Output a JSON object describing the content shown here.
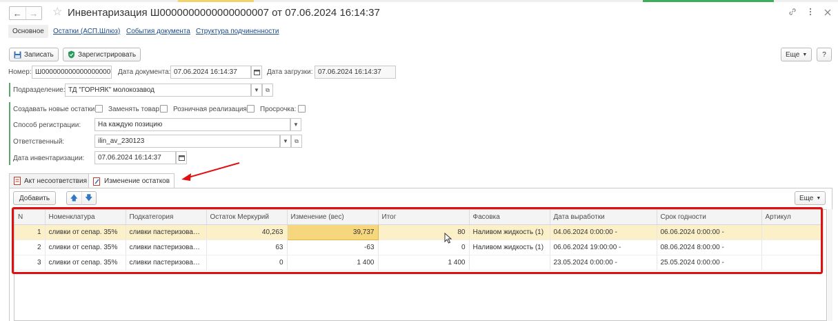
{
  "window": {
    "title": "Инвентаризация Ш0000000000000000007 от 07.06.2024 16:14:37",
    "nav_back": "←",
    "nav_forward": "→",
    "star": "☆",
    "icons": [
      "link-icon",
      "more-icon",
      "close-icon"
    ]
  },
  "sections": {
    "main": "Основное",
    "links": [
      "Остатки (АСП.Шлюз)",
      "События документа",
      "Структура подчиненности"
    ]
  },
  "toolbar": {
    "save_label": "Записать",
    "register_label": "Зарегистрировать",
    "more_label": "Еще",
    "help_label": "?"
  },
  "header": {
    "number_label": "Номер:",
    "number_value": "Ш0000000000000000007",
    "doc_date_label": "Дата документа:",
    "doc_date_value": "07.06.2024 16:14:37",
    "load_date_label": "Дата загрузки:",
    "load_date_value": "07.06.2024 16:14:37",
    "division_label": "Подразделение:",
    "division_value": "ТД \"ГОРНЯК\" молокозавод"
  },
  "options": {
    "create_new_label": "Создавать новые остатки:",
    "replace_goods_label": "Заменять товар:",
    "retail_label": "Розничная реализация:",
    "expired_label": "Просрочка:",
    "reg_method_label": "Способ регистрации:",
    "reg_method_value": "На каждую позицию",
    "responsible_label": "Ответственный:",
    "responsible_value": "ilin_av_230123",
    "inv_date_label": "Дата инвентаризации:",
    "inv_date_value": "07.06.2024 16:14:37"
  },
  "tabs": [
    {
      "label": "Акт несоответствия"
    },
    {
      "label": "Изменение остатков"
    }
  ],
  "table_toolbar": {
    "add_label": "Добавить",
    "up": "🡅",
    "down": "🡇",
    "more_label": "Еще"
  },
  "table": {
    "columns": [
      "N",
      "Номенклатура",
      "Подкатегория",
      "Остаток Меркурий",
      "Изменение (вес)",
      "Итог",
      "Фасовка",
      "Дата выработки",
      "Срок годности",
      "Артикул"
    ],
    "rows": [
      [
        "1",
        "сливки от сепар. 35%",
        "сливки пастеризован...",
        "40,263",
        "39,737",
        "80",
        "Наливом жидкость (1)",
        "04.06.2024 0:00:00 -",
        "06.06.2024 0:00:00 -",
        ""
      ],
      [
        "2",
        "сливки от сепар. 35%",
        "сливки пастеризован...",
        "63",
        "-63",
        "0",
        "Наливом жидкость (1)",
        "06.06.2024 19:00:00 -",
        "08.06.2024 8:00:00 -",
        ""
      ],
      [
        "3",
        "сливки от сепар. 35%",
        "сливки пастеризован...",
        "0",
        "1 400",
        "1 400",
        "",
        "23.05.2024 0:00:00 -",
        "25.05.2024 0:00:00 -",
        ""
      ]
    ]
  },
  "colors": {
    "annotation_red": "#e01010",
    "selected_row": "#fbf0c8",
    "current_cell": "#f6d77e",
    "accent_green": "#5aa66a",
    "link_blue": "#1a4a8a"
  }
}
